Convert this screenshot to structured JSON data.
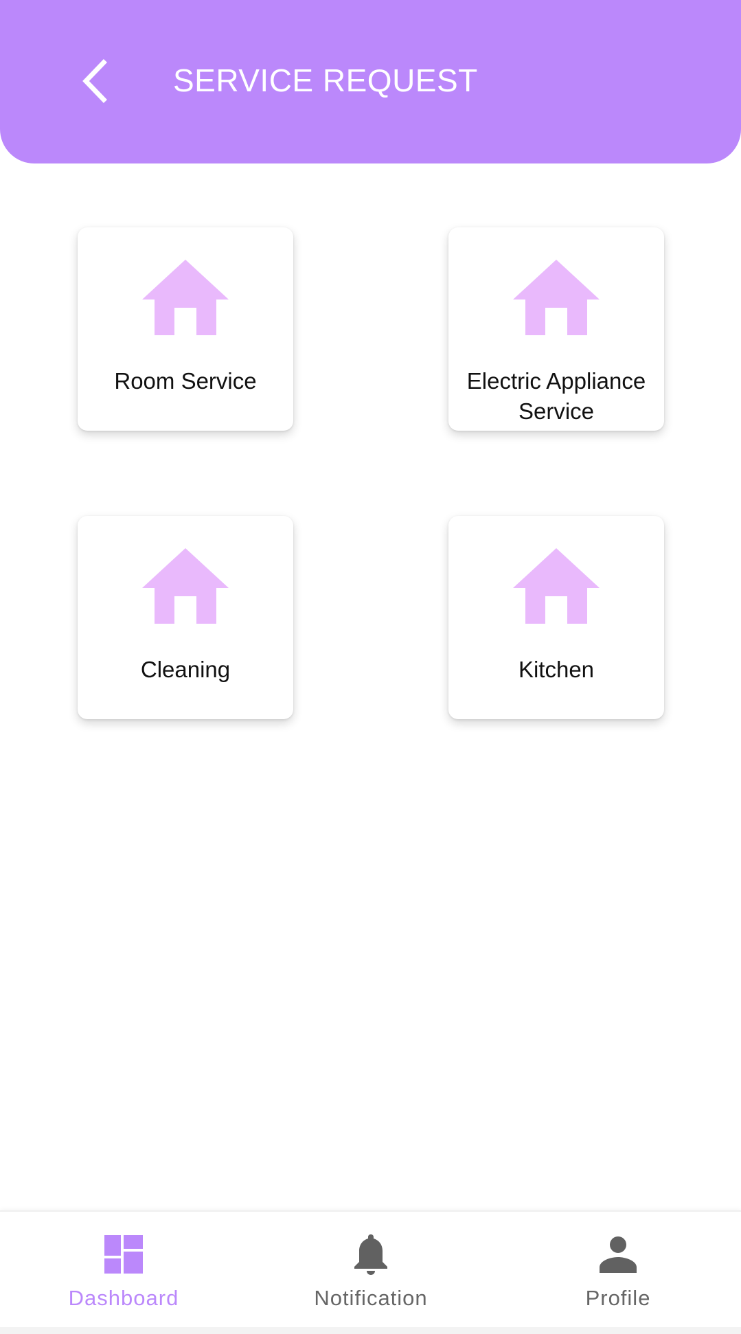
{
  "colors": {
    "header_bg": "#bb88fb",
    "icon_tint": "#e9b9fc",
    "active_nav": "#bb88fb",
    "inactive_nav": "#666666"
  },
  "header": {
    "back_icon": "chevron-left-icon",
    "title": "SERVICE REQUEST"
  },
  "services": [
    {
      "label": "Room Service",
      "icon": "home-icon"
    },
    {
      "label": "Electric Appliance Service",
      "icon": "home-icon"
    },
    {
      "label": "Cleaning",
      "icon": "home-icon"
    },
    {
      "label": "Kitchen",
      "icon": "home-icon"
    }
  ],
  "bottom_nav": {
    "items": [
      {
        "label": "Dashboard",
        "icon": "dashboard-icon",
        "active": true
      },
      {
        "label": "Notification",
        "icon": "bell-icon",
        "active": false
      },
      {
        "label": "Profile",
        "icon": "person-icon",
        "active": false
      }
    ]
  }
}
